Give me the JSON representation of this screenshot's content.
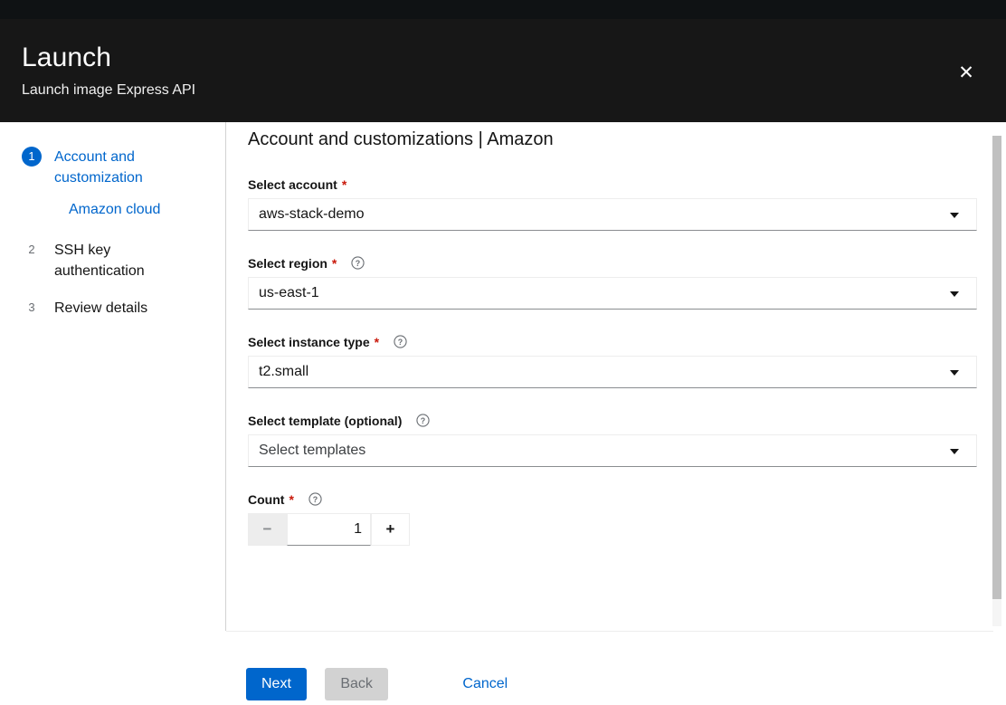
{
  "window": {
    "title": "Launch",
    "subtitle": "Launch image Express API",
    "close_label": "✕",
    "close_icon": "close-icon"
  },
  "colors": {
    "accent": "#0066cc",
    "header_bg": "#171717",
    "top_strip": "#0f1214",
    "required": "#c9190b",
    "disabled_bg": "#d2d2d2"
  },
  "sidebar": {
    "steps": [
      {
        "number": "1",
        "label": "Account and customization",
        "active": true
      },
      {
        "number": "2",
        "label": "SSH key authentication",
        "active": false
      },
      {
        "number": "3",
        "label": "Review details",
        "active": false
      }
    ],
    "substep": {
      "label": "Amazon cloud"
    }
  },
  "main": {
    "page_title": "Account and customizations | Amazon",
    "fields": [
      {
        "label": "Select account",
        "required": true,
        "has_help": false,
        "type": "select",
        "value": "aws-stack-demo",
        "is_placeholder": false
      },
      {
        "label": "Select region",
        "required": true,
        "has_help": true,
        "type": "select",
        "value": "us-east-1",
        "is_placeholder": false
      },
      {
        "label": "Select instance type",
        "required": true,
        "has_help": true,
        "type": "select",
        "value": "t2.small",
        "is_placeholder": false
      },
      {
        "label": "Select template (optional)",
        "required": false,
        "has_help": true,
        "type": "select",
        "value": "Select templates",
        "is_placeholder": true
      },
      {
        "label": "Count",
        "required": true,
        "has_help": true,
        "type": "stepper",
        "value": "1",
        "minus_label": "−",
        "plus_label": "+"
      }
    ],
    "help_icon": "question-circle-icon"
  },
  "footer": {
    "next_label": "Next",
    "back_label": "Back",
    "cancel_label": "Cancel",
    "back_disabled": true
  }
}
